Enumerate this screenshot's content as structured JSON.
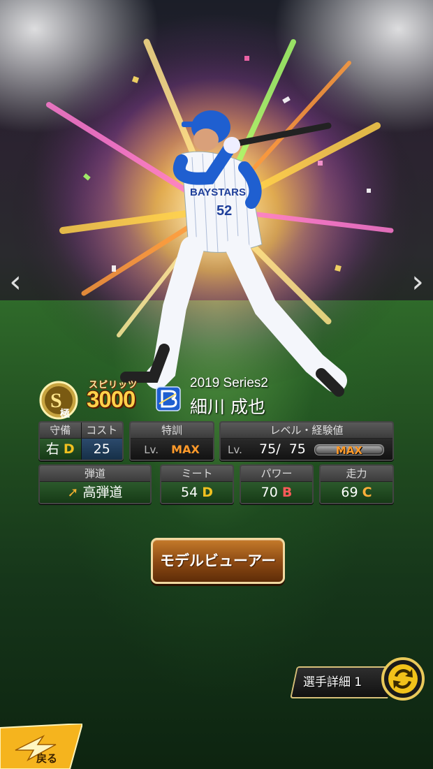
{
  "nav": {
    "prev_icon": "‹",
    "next_icon": "›"
  },
  "card": {
    "rank_icon": "S-rank-kiwami-badge",
    "rank_letter": "S",
    "rank_sub": "極",
    "spirits_label": "スピリッツ",
    "spirits_value": "3000",
    "team_logo": "baystars-logo",
    "series": "2019 Series2",
    "player_name": "細川 成也",
    "uniform_number": "52",
    "uniform_text": "BAYSTARS"
  },
  "stats": {
    "defense": {
      "label": "守備",
      "position": "右",
      "grade": "D"
    },
    "cost": {
      "label": "コスト",
      "value": "25"
    },
    "training": {
      "label": "特訓",
      "lv_prefix": "Lv.",
      "value": "MAX"
    },
    "level": {
      "label": "レベル・経験値",
      "lv_prefix": "Lv.",
      "current": "75",
      "separator": "/",
      "max": "75",
      "exp_label": "MAX",
      "exp_fraction": 1.0
    },
    "trajectory": {
      "label": "弾道",
      "value": "高弾道",
      "icon": "up-right-arrow-icon"
    },
    "meet": {
      "label": "ミート",
      "value": "54",
      "grade": "D"
    },
    "power": {
      "label": "パワー",
      "value": "70",
      "grade": "B"
    },
    "speed": {
      "label": "走力",
      "value": "69",
      "grade": "C"
    }
  },
  "actions": {
    "model_viewer": "モデルビューアー",
    "player_detail": "選手詳細 1",
    "back": "戻る"
  },
  "colors": {
    "grade_d": "#f0c020",
    "grade_b": "#ff5a5a",
    "grade_c": "#ffb03a",
    "max": "#ff9a2a",
    "button_border": "#f2d9a0",
    "back_button": "#f5b41e"
  }
}
